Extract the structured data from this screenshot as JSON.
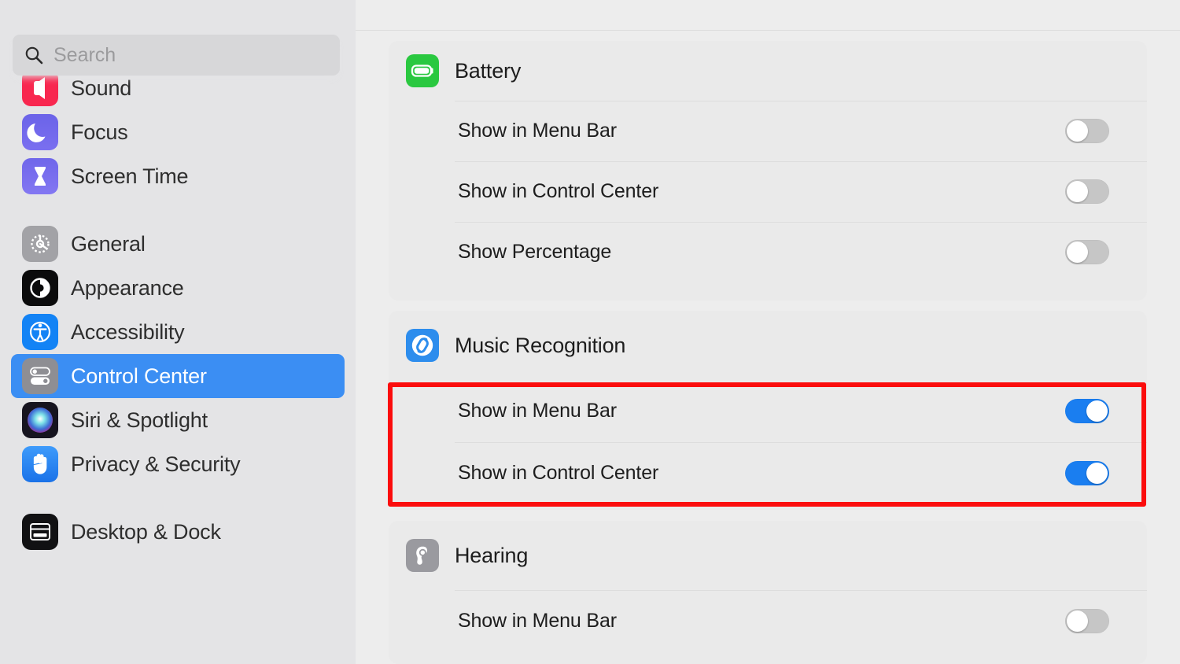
{
  "app": {
    "title": "System Settings",
    "accent_color": "#3b8ef3",
    "annotation_color": "#fb0d0d",
    "toggle_on_color": "#1a7ef0",
    "toggle_off_color": "#c6c6c6"
  },
  "sidebar": {
    "search": {
      "placeholder": "Search",
      "value": "",
      "icon": "search-icon"
    },
    "items": [
      {
        "label": "Sound",
        "icon": "sound-icon",
        "selected": false,
        "clipped": true
      },
      {
        "label": "Focus",
        "icon": "focus-icon",
        "selected": false
      },
      {
        "label": "Screen Time",
        "icon": "screen-time-icon",
        "selected": false
      },
      {
        "label": "General",
        "icon": "general-gear-icon",
        "selected": false
      },
      {
        "label": "Appearance",
        "icon": "appearance-icon",
        "selected": false
      },
      {
        "label": "Accessibility",
        "icon": "accessibility-icon",
        "selected": false
      },
      {
        "label": "Control Center",
        "icon": "control-center-icon",
        "selected": true
      },
      {
        "label": "Siri & Spotlight",
        "icon": "siri-icon",
        "selected": false
      },
      {
        "label": "Privacy & Security",
        "icon": "privacy-hand-icon",
        "selected": false
      },
      {
        "label": "Desktop & Dock",
        "icon": "desktop-dock-icon",
        "selected": false
      }
    ]
  },
  "main": {
    "sections": [
      {
        "title": "Battery",
        "icon": "battery-icon",
        "rows": [
          {
            "label": "Show in Menu Bar",
            "toggle": "off"
          },
          {
            "label": "Show in Control Center",
            "toggle": "off"
          },
          {
            "label": "Show Percentage",
            "toggle": "off"
          }
        ]
      },
      {
        "title": "Music Recognition",
        "icon": "shazam-icon",
        "highlighted": true,
        "rows": [
          {
            "label": "Show in Menu Bar",
            "toggle": "on"
          },
          {
            "label": "Show in Control Center",
            "toggle": "on"
          }
        ]
      },
      {
        "title": "Hearing",
        "icon": "hearing-ear-icon",
        "rows": [
          {
            "label": "Show in Menu Bar",
            "toggle": "off"
          }
        ]
      }
    ]
  }
}
